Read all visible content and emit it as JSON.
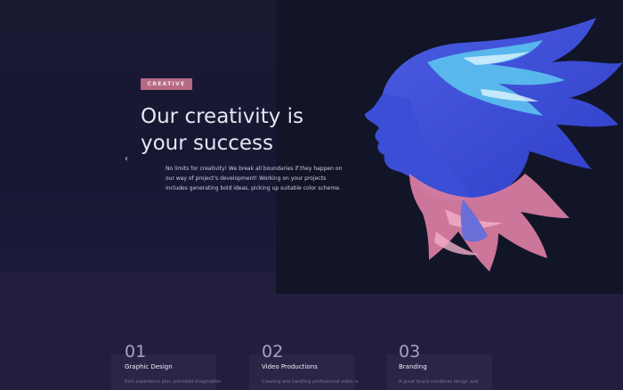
{
  "hero": {
    "tag": "CREATIVE",
    "title_line1": "Our creativity is",
    "title_line2": "your success",
    "description": "No limits for creativity! We break all boundaries if they happen on our way of project's development! Working on your projects includes generating bold ideas, picking up suitable color scheme.",
    "prev_icon": "chevron-left-icon",
    "prev_glyph": "‹",
    "art_name": "abstract-face-illustration"
  },
  "services": [
    {
      "number": "01",
      "title": "Graphic Design",
      "text": "Rich experience plus unlimited imagination"
    },
    {
      "number": "02",
      "title": "Video Productions",
      "text": "Creating and handling professional video is"
    },
    {
      "number": "03",
      "title": "Branding",
      "text": "A great brand combines design and"
    }
  ],
  "colors": {
    "accent": "#b56a84",
    "hero_bg": "#1a1a33",
    "section_bg": "#221f3e",
    "art_blue": "#3f5bdc",
    "art_cyan": "#5dc9f0",
    "art_pink": "#d77ba0"
  }
}
